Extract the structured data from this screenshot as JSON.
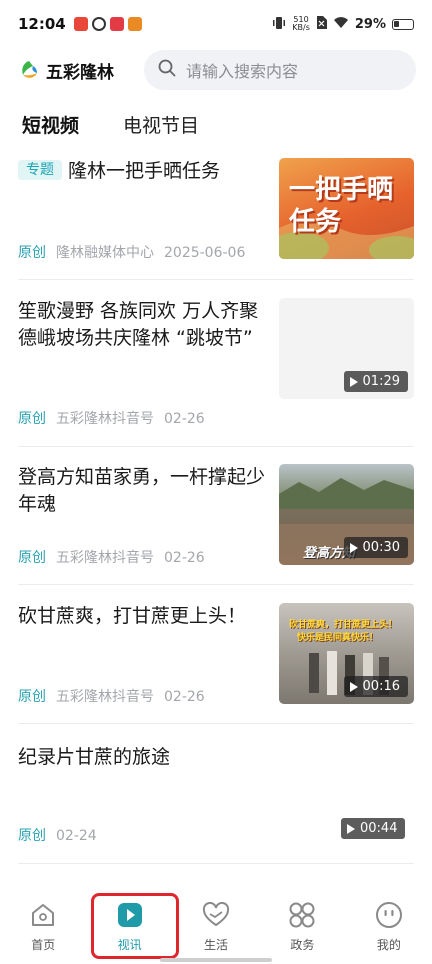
{
  "status_bar": {
    "time": "12:04",
    "net_speed_value": "510",
    "net_speed_unit": "KB/s",
    "battery": "29%"
  },
  "header": {
    "logo_text": "五彩隆林",
    "search_placeholder": "请输入搜索内容"
  },
  "tabs": [
    {
      "label": "短视频",
      "active": true
    },
    {
      "label": "电视节目",
      "active": false
    }
  ],
  "feed": [
    {
      "tag": "专题",
      "title": "隆林一把手晒任务",
      "source_type": "原创",
      "publisher": "隆林融媒体中心",
      "date": "2025-06-06",
      "thumb_caption": "一把手晒任务"
    },
    {
      "title": "笙歌漫野 各族同欢 万人齐聚德峨坡场共庆隆林 “跳坡节”",
      "source_type": "原创",
      "publisher": "五彩隆林抖音号",
      "date": "02-26",
      "duration": "01:29"
    },
    {
      "title": "登高方知苗家勇，一杆撑起少年魂",
      "source_type": "原创",
      "publisher": "五彩隆林抖音号",
      "date": "02-26",
      "duration": "00:30",
      "thumb_caption": "登高方知"
    },
    {
      "title": "砍甘蔗爽，打甘蔗更上头！",
      "source_type": "原创",
      "publisher": "五彩隆林抖音号",
      "date": "02-26",
      "duration": "00:16",
      "thumb_caption_1": "砍甘蔗爽，打甘蔗更上头！",
      "thumb_caption_2": "快乐是民间真快乐！"
    },
    {
      "title": "纪录片甘蔗的旅途",
      "source_type": "原创",
      "date": "02-24",
      "duration": "00:44"
    }
  ],
  "bottom_nav": [
    {
      "label": "首页",
      "icon": "home-icon"
    },
    {
      "label": "视讯",
      "icon": "video-play-icon",
      "active": true
    },
    {
      "label": "生活",
      "icon": "heart-hand-icon"
    },
    {
      "label": "政务",
      "icon": "grid-clover-icon"
    },
    {
      "label": "我的",
      "icon": "smile-icon"
    }
  ],
  "colors": {
    "accent": "#1f9aa8",
    "tag_bg": "#e2f5f6",
    "highlight": "#e0262d"
  }
}
